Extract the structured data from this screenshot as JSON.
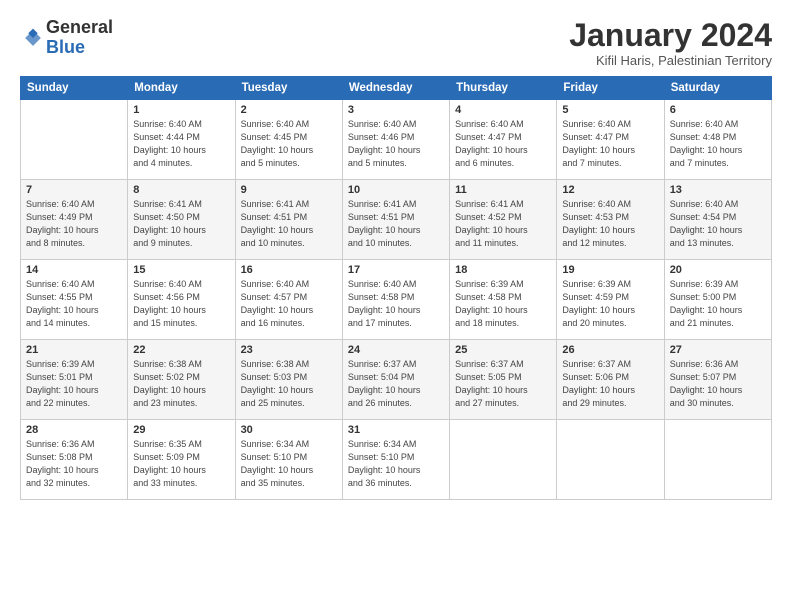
{
  "header": {
    "logo_general": "General",
    "logo_blue": "Blue",
    "month_title": "January 2024",
    "location": "Kifil Haris, Palestinian Territory"
  },
  "days_of_week": [
    "Sunday",
    "Monday",
    "Tuesday",
    "Wednesday",
    "Thursday",
    "Friday",
    "Saturday"
  ],
  "weeks": [
    [
      {
        "num": "",
        "info": ""
      },
      {
        "num": "1",
        "info": "Sunrise: 6:40 AM\nSunset: 4:44 PM\nDaylight: 10 hours\nand 4 minutes."
      },
      {
        "num": "2",
        "info": "Sunrise: 6:40 AM\nSunset: 4:45 PM\nDaylight: 10 hours\nand 5 minutes."
      },
      {
        "num": "3",
        "info": "Sunrise: 6:40 AM\nSunset: 4:46 PM\nDaylight: 10 hours\nand 5 minutes."
      },
      {
        "num": "4",
        "info": "Sunrise: 6:40 AM\nSunset: 4:47 PM\nDaylight: 10 hours\nand 6 minutes."
      },
      {
        "num": "5",
        "info": "Sunrise: 6:40 AM\nSunset: 4:47 PM\nDaylight: 10 hours\nand 7 minutes."
      },
      {
        "num": "6",
        "info": "Sunrise: 6:40 AM\nSunset: 4:48 PM\nDaylight: 10 hours\nand 7 minutes."
      }
    ],
    [
      {
        "num": "7",
        "info": "Sunrise: 6:40 AM\nSunset: 4:49 PM\nDaylight: 10 hours\nand 8 minutes."
      },
      {
        "num": "8",
        "info": "Sunrise: 6:41 AM\nSunset: 4:50 PM\nDaylight: 10 hours\nand 9 minutes."
      },
      {
        "num": "9",
        "info": "Sunrise: 6:41 AM\nSunset: 4:51 PM\nDaylight: 10 hours\nand 10 minutes."
      },
      {
        "num": "10",
        "info": "Sunrise: 6:41 AM\nSunset: 4:51 PM\nDaylight: 10 hours\nand 10 minutes."
      },
      {
        "num": "11",
        "info": "Sunrise: 6:41 AM\nSunset: 4:52 PM\nDaylight: 10 hours\nand 11 minutes."
      },
      {
        "num": "12",
        "info": "Sunrise: 6:40 AM\nSunset: 4:53 PM\nDaylight: 10 hours\nand 12 minutes."
      },
      {
        "num": "13",
        "info": "Sunrise: 6:40 AM\nSunset: 4:54 PM\nDaylight: 10 hours\nand 13 minutes."
      }
    ],
    [
      {
        "num": "14",
        "info": "Sunrise: 6:40 AM\nSunset: 4:55 PM\nDaylight: 10 hours\nand 14 minutes."
      },
      {
        "num": "15",
        "info": "Sunrise: 6:40 AM\nSunset: 4:56 PM\nDaylight: 10 hours\nand 15 minutes."
      },
      {
        "num": "16",
        "info": "Sunrise: 6:40 AM\nSunset: 4:57 PM\nDaylight: 10 hours\nand 16 minutes."
      },
      {
        "num": "17",
        "info": "Sunrise: 6:40 AM\nSunset: 4:58 PM\nDaylight: 10 hours\nand 17 minutes."
      },
      {
        "num": "18",
        "info": "Sunrise: 6:39 AM\nSunset: 4:58 PM\nDaylight: 10 hours\nand 18 minutes."
      },
      {
        "num": "19",
        "info": "Sunrise: 6:39 AM\nSunset: 4:59 PM\nDaylight: 10 hours\nand 20 minutes."
      },
      {
        "num": "20",
        "info": "Sunrise: 6:39 AM\nSunset: 5:00 PM\nDaylight: 10 hours\nand 21 minutes."
      }
    ],
    [
      {
        "num": "21",
        "info": "Sunrise: 6:39 AM\nSunset: 5:01 PM\nDaylight: 10 hours\nand 22 minutes."
      },
      {
        "num": "22",
        "info": "Sunrise: 6:38 AM\nSunset: 5:02 PM\nDaylight: 10 hours\nand 23 minutes."
      },
      {
        "num": "23",
        "info": "Sunrise: 6:38 AM\nSunset: 5:03 PM\nDaylight: 10 hours\nand 25 minutes."
      },
      {
        "num": "24",
        "info": "Sunrise: 6:37 AM\nSunset: 5:04 PM\nDaylight: 10 hours\nand 26 minutes."
      },
      {
        "num": "25",
        "info": "Sunrise: 6:37 AM\nSunset: 5:05 PM\nDaylight: 10 hours\nand 27 minutes."
      },
      {
        "num": "26",
        "info": "Sunrise: 6:37 AM\nSunset: 5:06 PM\nDaylight: 10 hours\nand 29 minutes."
      },
      {
        "num": "27",
        "info": "Sunrise: 6:36 AM\nSunset: 5:07 PM\nDaylight: 10 hours\nand 30 minutes."
      }
    ],
    [
      {
        "num": "28",
        "info": "Sunrise: 6:36 AM\nSunset: 5:08 PM\nDaylight: 10 hours\nand 32 minutes."
      },
      {
        "num": "29",
        "info": "Sunrise: 6:35 AM\nSunset: 5:09 PM\nDaylight: 10 hours\nand 33 minutes."
      },
      {
        "num": "30",
        "info": "Sunrise: 6:34 AM\nSunset: 5:10 PM\nDaylight: 10 hours\nand 35 minutes."
      },
      {
        "num": "31",
        "info": "Sunrise: 6:34 AM\nSunset: 5:10 PM\nDaylight: 10 hours\nand 36 minutes."
      },
      {
        "num": "",
        "info": ""
      },
      {
        "num": "",
        "info": ""
      },
      {
        "num": "",
        "info": ""
      }
    ]
  ]
}
